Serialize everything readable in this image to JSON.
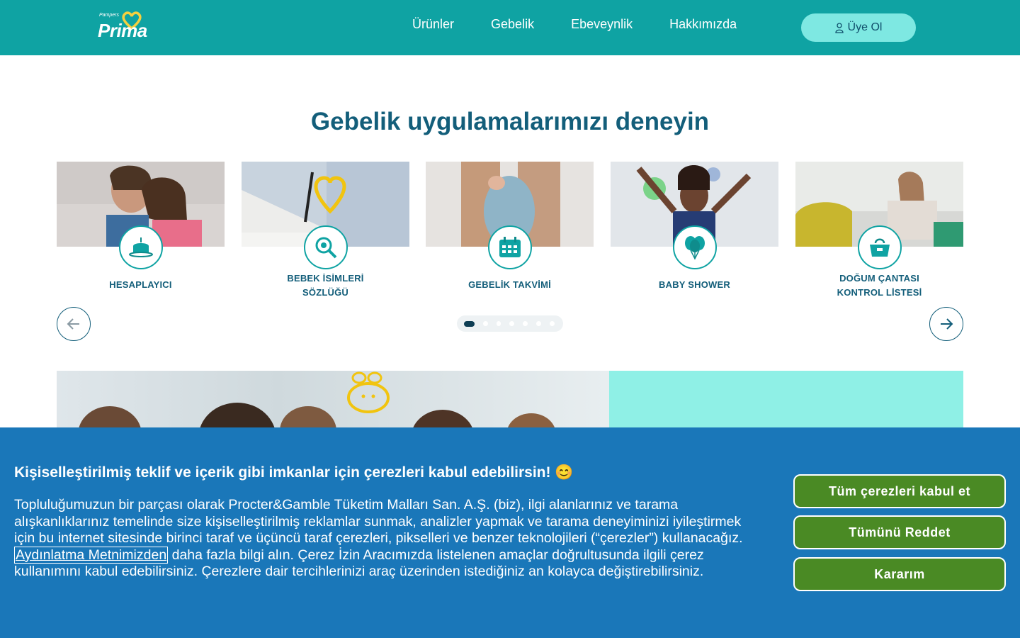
{
  "header": {
    "logo_small": "Pampers",
    "logo_main": "Prima",
    "nav": [
      "Ürünler",
      "Gebelik",
      "Ebeveynlik",
      "Hakkımızda"
    ],
    "signup_label": "Üye Ol"
  },
  "section": {
    "title": "Gebelik uygulamalarımızı deneyin"
  },
  "cards": [
    {
      "line1": "HESAPLAYICI",
      "line2": "",
      "icon": "cake-icon"
    },
    {
      "line1": "BEBEK İSİMLERİ",
      "line2": "SÖZLÜĞÜ",
      "icon": "magnifier-icon"
    },
    {
      "line1": "GEBELİK TAKVİMİ",
      "line2": "",
      "icon": "calendar-icon"
    },
    {
      "line1": "BABY SHOWER",
      "line2": "",
      "icon": "balloons-icon"
    },
    {
      "line1": "DOĞUM ÇANTASI",
      "line2": "KONTROL LİSTESİ",
      "icon": "bag-icon"
    }
  ],
  "carousel": {
    "page_count": 7,
    "active_page": 1
  },
  "cookie": {
    "title": "Kişiselleştirilmiş teklif ve içerik gibi imkanlar için çerezleri kabul edebilirsin! 😊",
    "text_before": "Topluluğumuzun bir parçası olarak Procter&Gamble Tüketim Malları San. A.Ş. (biz), ilgi alanlarınız ve tarama alışkanlıklarınız temelinde size kişiselleştirilmiş reklamlar sunmak, analizler yapmak ve tarama deneyiminizi iyileştirmek için bu internet sitesinde birinci taraf ve üçüncü taraf çerezleri, pikselleri ve benzer teknolojileri (“çerezler”) kullanacağız.",
    "link": "Aydınlatma Metnimizden",
    "text_after": "daha fazla bilgi alın. Çerez İzin Aracımızda listelenen amaçlar doğrultusunda ilgili çerez kullanımını kabul edebilirsiniz. Çerezlere dair tercihlerinizi araç üzerinden istediğiniz an kolayca değiştirebilirsiniz.",
    "accept_all": "Tüm çerezleri kabul et",
    "reject_all": "Tümünü Reddet",
    "my_choice": "Kararım"
  },
  "colors": {
    "header_bg": "#0fa3a3",
    "title_color": "#135e7a",
    "cookie_bg": "#1a77b9",
    "cookie_btn": "#4a8a24"
  }
}
